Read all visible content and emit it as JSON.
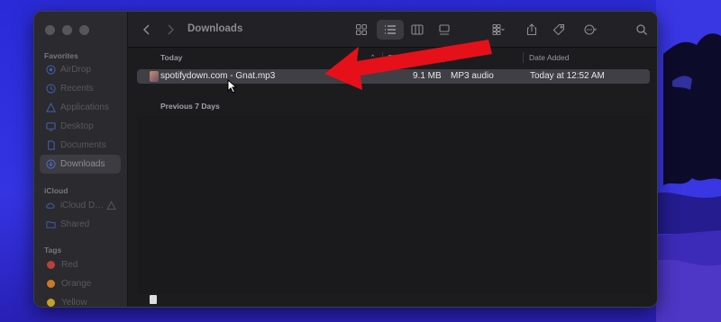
{
  "window": {
    "title": "Downloads"
  },
  "sidebar": {
    "sections": [
      {
        "heading": "Favorites",
        "items": [
          {
            "label": "AirDrop",
            "icon": "airdrop-icon"
          },
          {
            "label": "Recents",
            "icon": "clock-icon"
          },
          {
            "label": "Applications",
            "icon": "applications-icon"
          },
          {
            "label": "Desktop",
            "icon": "desktop-icon"
          },
          {
            "label": "Documents",
            "icon": "document-icon"
          },
          {
            "label": "Downloads",
            "icon": "download-icon",
            "active": true
          }
        ]
      },
      {
        "heading": "iCloud",
        "items": [
          {
            "label": "iCloud D…",
            "icon": "cloud-icon",
            "warning": true
          },
          {
            "label": "Shared",
            "icon": "shared-folder-icon"
          }
        ]
      },
      {
        "heading": "Tags",
        "items": [
          {
            "label": "Red",
            "color": "#b8403e"
          },
          {
            "label": "Orange",
            "color": "#c97a24"
          },
          {
            "label": "Yellow",
            "color": "#c2a12b"
          }
        ]
      }
    ]
  },
  "columns": {
    "name": "Today",
    "size": "Si",
    "kind": "",
    "date_added": "Date Added"
  },
  "groups": [
    {
      "label": "Today",
      "files": [
        {
          "name": "spotifydown.com - Gnat.mp3",
          "size": "9.1 MB",
          "kind": "MP3 audio",
          "date_added": "Today at 12:52 AM",
          "selected": true
        }
      ]
    },
    {
      "label": "Previous 7 Days",
      "files": []
    }
  ],
  "annotation": {
    "arrow_color": "#e5101a"
  }
}
